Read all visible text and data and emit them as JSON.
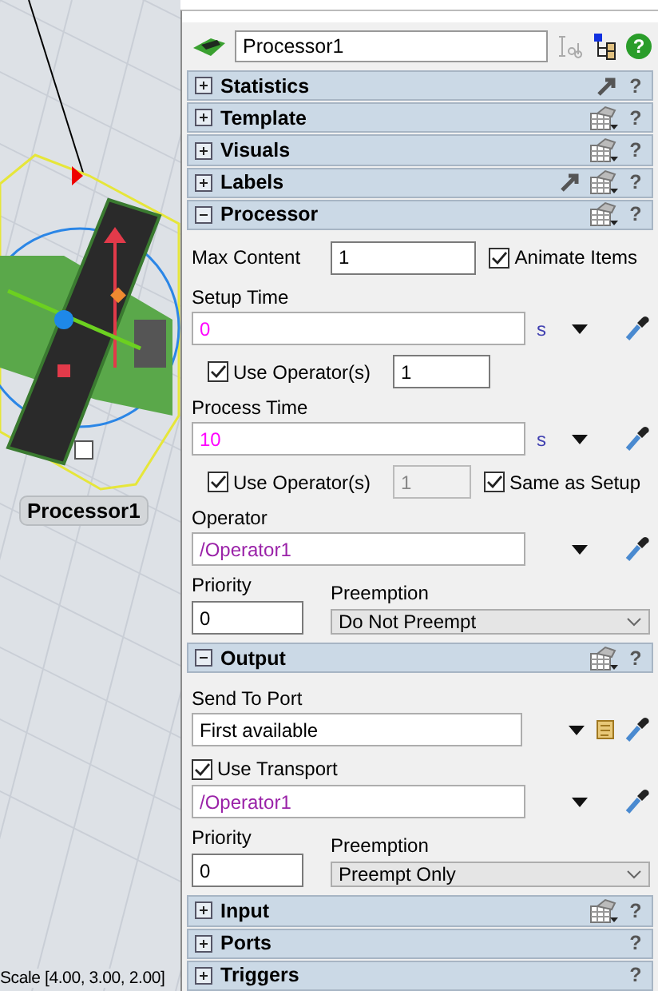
{
  "viewport": {
    "object_label": "Processor1",
    "status": "Scale [4.00, 3.00, 2.00]"
  },
  "panel": {
    "name": "Processor1",
    "help": "?"
  },
  "sections": [
    {
      "title": "Statistics",
      "expanded": false,
      "pointer": true,
      "menu": false,
      "help": "?"
    },
    {
      "title": "Template",
      "expanded": false,
      "pointer": false,
      "menu": true,
      "help": "?"
    },
    {
      "title": "Visuals",
      "expanded": false,
      "pointer": false,
      "menu": true,
      "help": "?"
    },
    {
      "title": "Labels",
      "expanded": false,
      "pointer": true,
      "menu": true,
      "help": "?"
    },
    {
      "title": "Processor",
      "expanded": true,
      "pointer": false,
      "menu": true,
      "help": "?",
      "items": [
        {
          "kind": "field_check",
          "label": "Max Content",
          "value": "1",
          "check_label": "Animate Items",
          "checked": true
        },
        {
          "kind": "code",
          "label": "Setup Time",
          "value": "0",
          "color": "#ff00ff",
          "unit": "s",
          "template": false
        },
        {
          "kind": "operators",
          "label": "Use Operator(s)",
          "checked": true,
          "value": "1",
          "disabled": false
        },
        {
          "kind": "code",
          "label": "Process Time",
          "value": "10",
          "color": "#ff00ff",
          "unit": "s",
          "template": false
        },
        {
          "kind": "operators",
          "label": "Use Operator(s)",
          "checked": true,
          "value": "1",
          "disabled": true,
          "extra_label": "Same as Setup",
          "extra_checked": true
        },
        {
          "kind": "code",
          "label": "Operator",
          "value": "/Operator1",
          "color": "#9a22a8",
          "template": false
        },
        {
          "kind": "priority",
          "label": "Priority",
          "value": "0",
          "select_label": "Preemption",
          "select_value": "Do Not Preempt"
        }
      ]
    },
    {
      "title": "Output",
      "expanded": true,
      "pointer": false,
      "menu": true,
      "help": "?",
      "items": [
        {
          "kind": "code",
          "label": "Send To Port",
          "value": "First available",
          "color": "#000000",
          "template": true
        },
        {
          "kind": "check",
          "label": "Use Transport",
          "checked": true
        },
        {
          "kind": "code",
          "value": "/Operator1",
          "color": "#9a22a8",
          "template": false
        },
        {
          "kind": "priority",
          "label": "Priority",
          "value": "0",
          "select_label": "Preemption",
          "select_value": "Preempt Only"
        }
      ]
    },
    {
      "title": "Input",
      "expanded": false,
      "pointer": false,
      "menu": true,
      "help": "?"
    },
    {
      "title": "Ports",
      "expanded": false,
      "pointer": false,
      "menu": false,
      "help": "?"
    },
    {
      "title": "Triggers",
      "expanded": false,
      "pointer": false,
      "menu": false,
      "help": "?"
    }
  ]
}
